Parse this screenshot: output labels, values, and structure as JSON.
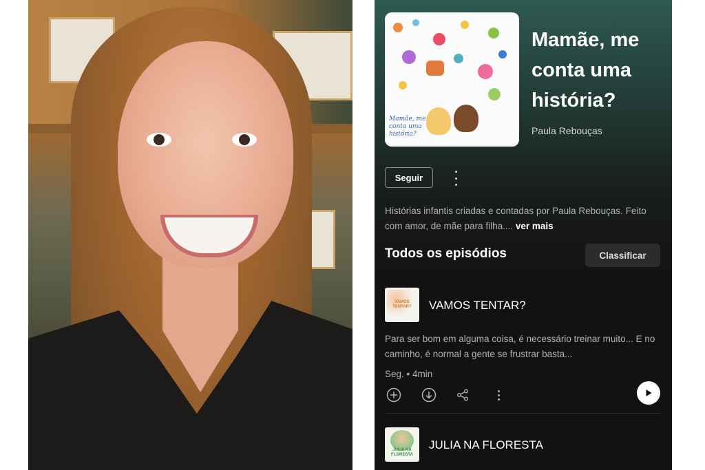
{
  "photo": {
    "description_icon": "portrait-photo"
  },
  "podcast": {
    "title": "Mamãe, me conta uma história?",
    "author": "Paula Rebouças",
    "cover_caption": "Mamãe, me conta uma história?",
    "follow_label": "Seguir",
    "description": "Histórias infantis criadas e contadas por Paula Rebouças. Feito com amor, de mãe para filha....",
    "see_more_label": "ver mais"
  },
  "episodes_section": {
    "title": "Todos os episódios",
    "sort_label": "Classificar"
  },
  "episodes": [
    {
      "title": "VAMOS TENTAR?",
      "thumb_text": "VAMOS TENTAR?",
      "description": "Para ser bom em alguma coisa, é necessário treinar muito... E no caminho, é normal a gente se frustrar basta...",
      "meta": "Seg. • 4min"
    },
    {
      "title": "JULIA NA FLORESTA",
      "thumb_text": "JULIA NA FLORESTA"
    }
  ],
  "colors": {
    "header_gradient": "#2e5a4f",
    "background": "#121212",
    "secondary_text": "#b3b3b3"
  }
}
